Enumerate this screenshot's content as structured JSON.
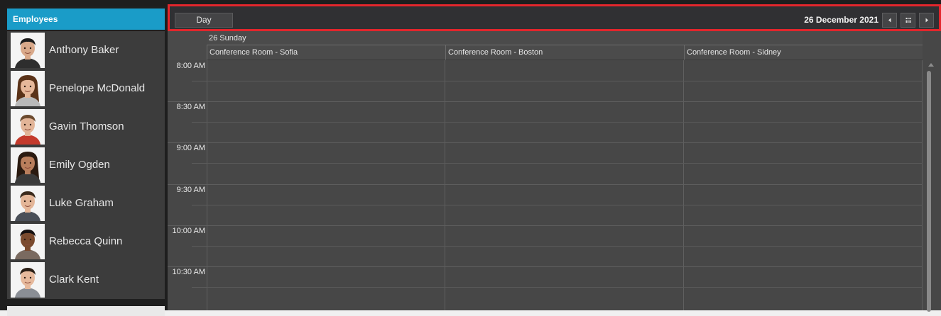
{
  "employees_panel": {
    "title": "Employees",
    "items": [
      {
        "name": "Anthony Baker",
        "avatar": "anthony-baker-photo"
      },
      {
        "name": "Penelope McDonald",
        "avatar": "penelope-mcdonald-photo"
      },
      {
        "name": "Gavin Thomson",
        "avatar": "gavin-thomson-photo"
      },
      {
        "name": "Emily Ogden",
        "avatar": "emily-ogden-photo"
      },
      {
        "name": "Luke Graham",
        "avatar": "luke-graham-photo"
      },
      {
        "name": "Rebecca Quinn",
        "avatar": "rebecca-quinn-photo"
      },
      {
        "name": "Clark Kent",
        "avatar": "clark-kent-photo"
      }
    ]
  },
  "scheduler": {
    "toolbar": {
      "view_button": "Day",
      "current_date": "26 December 2021",
      "prev_icon": "chevron-left-icon",
      "calendar_icon": "calendar-grid-icon",
      "next_icon": "chevron-right-icon"
    },
    "day_header": "26 Sunday",
    "resources": [
      "Conference Room - Sofia",
      "Conference Room - Boston",
      "Conference Room - Sidney"
    ],
    "time_slots": [
      "8:00 AM",
      "8:30 AM",
      "9:00 AM",
      "9:30 AM",
      "10:00 AM",
      "10:30 AM"
    ]
  },
  "colors": {
    "panel_header": "#1a9cc8",
    "toolbar_highlight": "#e3262c",
    "grid_background": "#474747"
  }
}
